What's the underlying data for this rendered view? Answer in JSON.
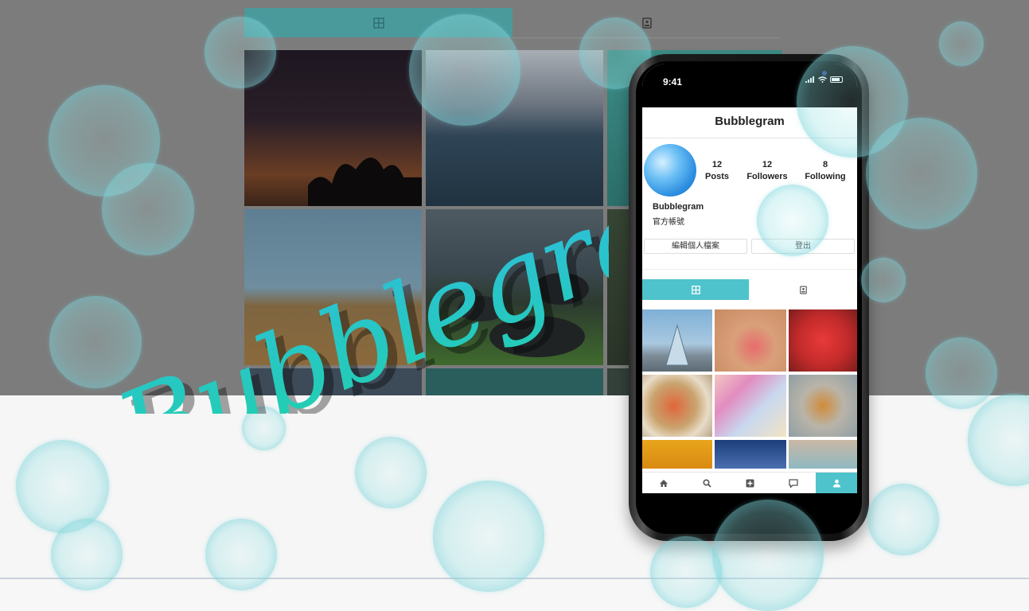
{
  "app": {
    "logo_text": "Bubblegram",
    "colors": {
      "accent": "#4fc3cc",
      "logo_start": "#1ed3a4",
      "logo_end": "#31b9e8"
    }
  },
  "phone": {
    "status_time": "9:41",
    "header_title": "Bubblegram",
    "profile": {
      "stats": [
        {
          "value": "12",
          "label": "Posts"
        },
        {
          "value": "12",
          "label": "Followers"
        },
        {
          "value": "8",
          "label": "Following"
        }
      ],
      "username": "Bubblegram",
      "bio": "官方帳號",
      "edit_button": "編輯個人檔案",
      "logout_button": "登出"
    },
    "tabs": [
      {
        "icon": "grid-icon",
        "active": true
      },
      {
        "icon": "tagged-icon",
        "active": false
      }
    ],
    "bottom_nav": [
      {
        "icon": "home-icon"
      },
      {
        "icon": "search-icon"
      },
      {
        "icon": "add-post-icon"
      },
      {
        "icon": "chat-icon"
      },
      {
        "icon": "profile-icon",
        "active": true
      }
    ]
  },
  "background_page": {
    "tabs": [
      {
        "icon": "grid-icon",
        "active": true
      },
      {
        "icon": "tagged-icon",
        "active": false
      }
    ]
  }
}
